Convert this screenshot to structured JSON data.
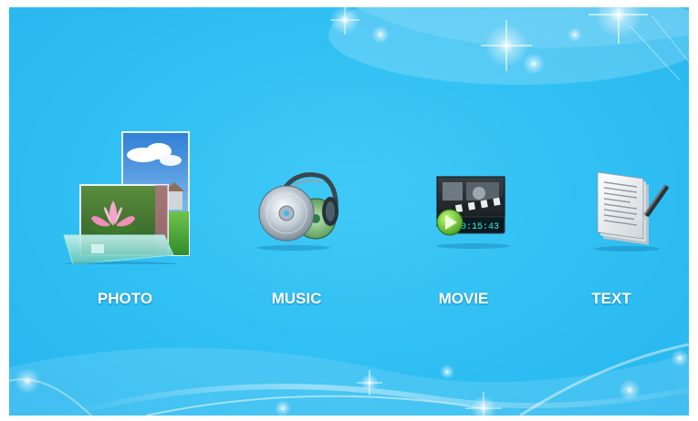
{
  "menu": {
    "items": [
      {
        "id": "photo",
        "label": "PHOTO",
        "icon": "photo-icon"
      },
      {
        "id": "music",
        "label": "MUSIC",
        "icon": "music-icon"
      },
      {
        "id": "movie",
        "label": "MOVIE",
        "icon": "movie-icon"
      },
      {
        "id": "text",
        "label": "TEXT",
        "icon": "text-icon"
      }
    ]
  },
  "movie_icon": {
    "timecode": "0:15:43"
  },
  "colors": {
    "background": "#30bff3",
    "label": "#ffffff",
    "sparkle": "#ffffff"
  }
}
